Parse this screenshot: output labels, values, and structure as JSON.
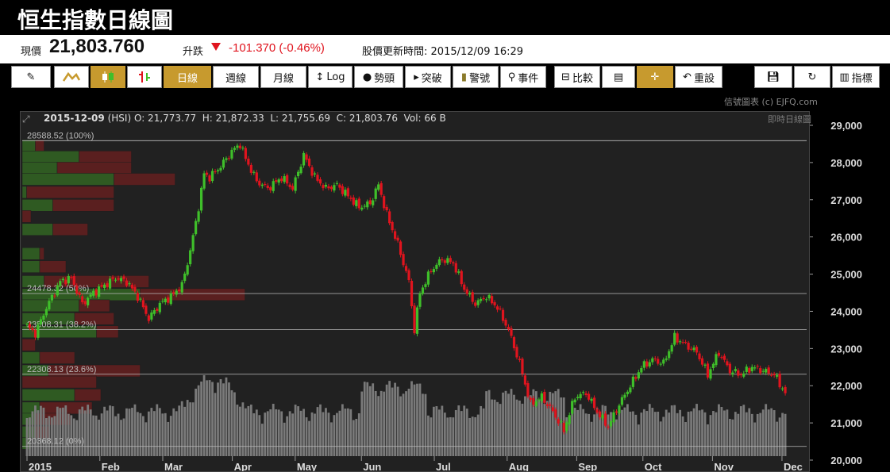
{
  "title": "恒生指數日線圖",
  "quote": {
    "price_label": "現價",
    "price": "21,803.760",
    "change_label": "升跌",
    "change": "-101.370 (-0.46%)",
    "update_label": "股價更新時間:",
    "update_time": "2015/12/09 16:29"
  },
  "toolbar": {
    "draw_icon": "pencil-icon",
    "line_icon": "line-chart-icon",
    "candle_icon": "candlestick-icon",
    "bar_icon": "ohlc-bar-icon",
    "daily": "日線",
    "weekly": "週線",
    "monthly": "月線",
    "log": "Log",
    "trend": "勢頭",
    "breakout": "突破",
    "alert": "警號",
    "events": "事件",
    "compare": "比較",
    "notes_icon": "notes-icon",
    "crosshair_icon": "crosshair-icon",
    "reset": "重設",
    "save_icon": "save-icon",
    "refresh_icon": "refresh-icon",
    "indicators": "指標"
  },
  "watermark": "信號圖表 (c) EJFQ.com",
  "realtime_label": "即時日線圖",
  "info": {
    "date": "2015-12-09",
    "symbol": "(HSI)",
    "open": "O: 21,773.77",
    "high": "H: 21,872.33",
    "low": "L: 21,755.69",
    "close": "C: 21,803.76",
    "vol": "Vol: 66 B"
  },
  "colors": {
    "up": "#3fbf2a",
    "down": "#e0141e",
    "accent": "#c79a2e",
    "volume": "#7a7a7a"
  },
  "chart_data": {
    "type": "candlestick",
    "ylim": [
      20000,
      29000
    ],
    "yticks": [
      20000,
      21000,
      22000,
      23000,
      24000,
      25000,
      26000,
      27000,
      28000,
      29000
    ],
    "ytick_labels": [
      "20,000",
      "21,000",
      "22,000",
      "23,000",
      "24,000",
      "25,000",
      "26,000",
      "27,000",
      "28,000",
      "29,000"
    ],
    "x_labels": [
      {
        "label": "2015",
        "day": 0
      },
      {
        "label": "Feb",
        "day": 22
      },
      {
        "label": "Mar",
        "day": 41
      },
      {
        "label": "Apr",
        "day": 62
      },
      {
        "label": "May",
        "day": 81
      },
      {
        "label": "Jun",
        "day": 101
      },
      {
        "label": "Jul",
        "day": 123
      },
      {
        "label": "Aug",
        "day": 145
      },
      {
        "label": "Sep",
        "day": 166
      },
      {
        "label": "Oct",
        "day": 186
      },
      {
        "label": "Nov",
        "day": 207
      },
      {
        "label": "Dec",
        "day": 228
      }
    ],
    "n_days": 234,
    "fib_levels": [
      {
        "label": "28588.52 (100%)",
        "value": 28588.52
      },
      {
        "label": "24478.32 (50%)",
        "value": 24478.32
      },
      {
        "label": "23508.31 (38.2%)",
        "value": 23508.31
      },
      {
        "label": "22308.13 (23.6%)",
        "value": 22308.13
      },
      {
        "label": "20368.12 (0%)",
        "value": 20368.12
      }
    ],
    "volume_profile": [
      {
        "price": 28450,
        "up": 3,
        "down": 2
      },
      {
        "price": 28150,
        "up": 13,
        "down": 12
      },
      {
        "price": 27850,
        "up": 8,
        "down": 17
      },
      {
        "price": 27550,
        "up": 21,
        "down": 14
      },
      {
        "price": 27200,
        "up": 1,
        "down": 20
      },
      {
        "price": 26850,
        "up": 7,
        "down": 14
      },
      {
        "price": 26550,
        "up": 0,
        "down": 2
      },
      {
        "price": 26200,
        "up": 7,
        "down": 8
      },
      {
        "price": 25800,
        "up": 0,
        "down": 0
      },
      {
        "price": 25550,
        "up": 4,
        "down": 1
      },
      {
        "price": 25200,
        "up": 4,
        "down": 6
      },
      {
        "price": 24800,
        "up": 5,
        "down": 24
      },
      {
        "price": 24450,
        "up": 27,
        "down": 24
      },
      {
        "price": 24150,
        "up": 13,
        "down": 7
      },
      {
        "price": 23800,
        "up": 12,
        "down": 9
      },
      {
        "price": 23450,
        "up": 17,
        "down": 5
      },
      {
        "price": 23100,
        "up": 0,
        "down": 3
      },
      {
        "price": 22750,
        "up": 4,
        "down": 8
      },
      {
        "price": 22400,
        "up": 6,
        "down": 21
      },
      {
        "price": 22100,
        "up": 0,
        "down": 17
      },
      {
        "price": 21750,
        "up": 12,
        "down": 6
      },
      {
        "price": 21400,
        "up": 4,
        "down": 12
      },
      {
        "price": 21100,
        "up": 3,
        "down": 8
      },
      {
        "price": 20750,
        "up": 3,
        "down": 3
      },
      {
        "price": 20450,
        "up": 2,
        "down": 0
      }
    ],
    "ohlc_keypoints": [
      [
        0,
        23600
      ],
      [
        3,
        23400
      ],
      [
        7,
        24100
      ],
      [
        12,
        24800
      ],
      [
        16,
        24900
      ],
      [
        20,
        24200
      ],
      [
        24,
        24500
      ],
      [
        28,
        24700
      ],
      [
        32,
        24900
      ],
      [
        36,
        24800
      ],
      [
        40,
        24400
      ],
      [
        44,
        23800
      ],
      [
        48,
        24200
      ],
      [
        52,
        24400
      ],
      [
        56,
        24700
      ],
      [
        58,
        25300
      ],
      [
        60,
        26000
      ],
      [
        62,
        26800
      ],
      [
        64,
        27700
      ],
      [
        66,
        27600
      ],
      [
        70,
        27900
      ],
      [
        74,
        28300
      ],
      [
        77,
        28500
      ],
      [
        79,
        28100
      ],
      [
        83,
        27500
      ],
      [
        87,
        27300
      ],
      [
        92,
        27600
      ],
      [
        96,
        27300
      ],
      [
        100,
        28200
      ],
      [
        104,
        27600
      ],
      [
        108,
        27300
      ],
      [
        112,
        27400
      ],
      [
        116,
        27100
      ],
      [
        120,
        26800
      ],
      [
        124,
        26900
      ],
      [
        127,
        27400
      ],
      [
        130,
        26600
      ],
      [
        134,
        25800
      ],
      [
        138,
        24800
      ],
      [
        140,
        23500
      ],
      [
        142,
        24500
      ],
      [
        146,
        25100
      ],
      [
        150,
        25400
      ],
      [
        154,
        25300
      ],
      [
        158,
        24600
      ],
      [
        162,
        24200
      ],
      [
        166,
        24400
      ],
      [
        170,
        24100
      ],
      [
        174,
        23500
      ],
      [
        178,
        22600
      ],
      [
        182,
        21500
      ],
      [
        186,
        21700
      ],
      [
        190,
        21300
      ],
      [
        194,
        20800
      ],
      [
        198,
        21700
      ],
      [
        202,
        21800
      ],
      [
        206,
        21300
      ],
      [
        210,
        20900
      ],
      [
        214,
        21500
      ],
      [
        218,
        22000
      ],
      [
        222,
        22500
      ],
      [
        226,
        22700
      ],
      [
        230,
        22600
      ],
      [
        234,
        23300
      ],
      [
        238,
        23100
      ],
      [
        242,
        22900
      ],
      [
        246,
        22300
      ],
      [
        250,
        22900
      ],
      [
        254,
        22400
      ],
      [
        258,
        22300
      ],
      [
        262,
        22500
      ],
      [
        266,
        22400
      ],
      [
        270,
        22300
      ],
      [
        274,
        21800
      ]
    ]
  }
}
